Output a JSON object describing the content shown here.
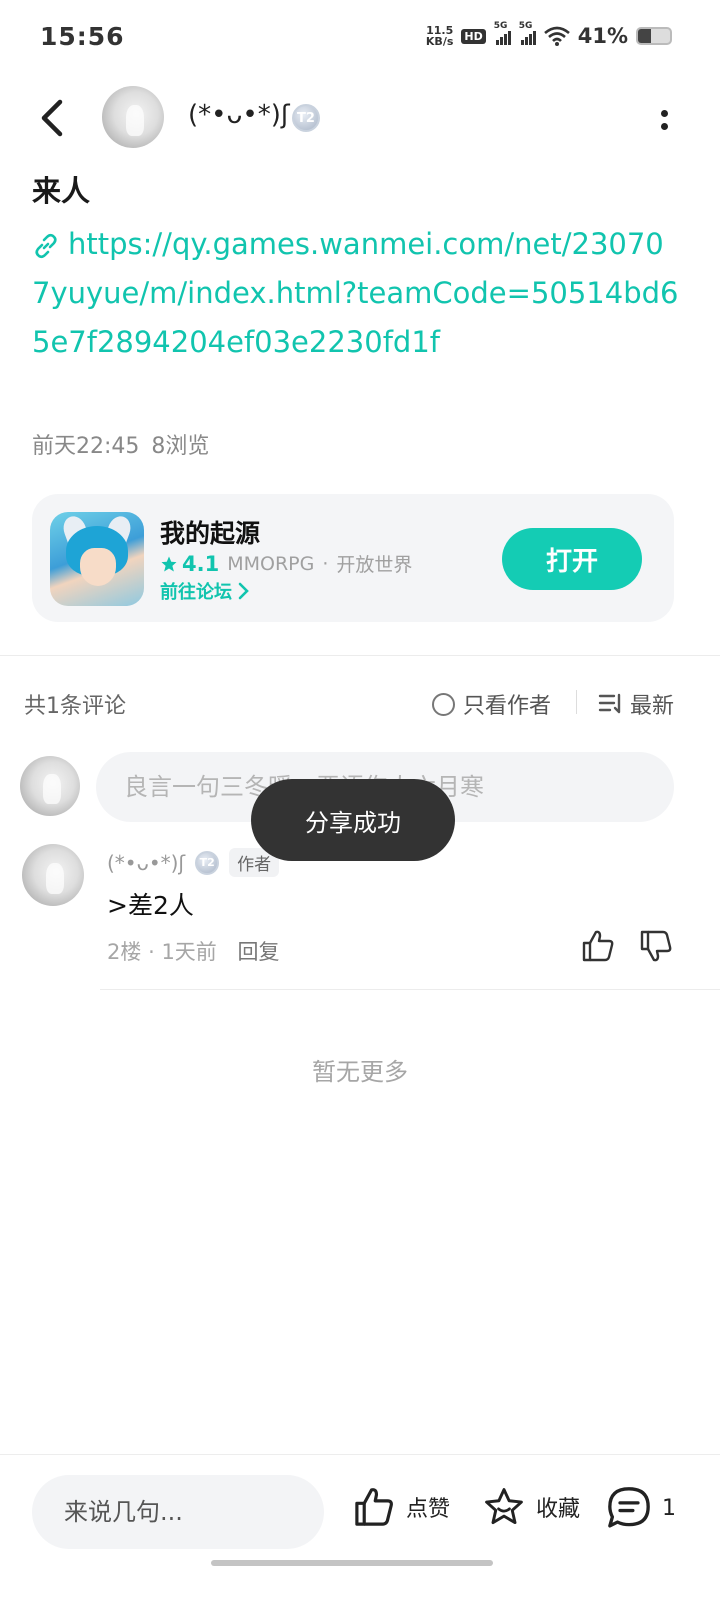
{
  "status_bar": {
    "time": "15:56",
    "net_speed_value": "11.5",
    "net_speed_unit": "KB/s",
    "hd_label": "HD",
    "signal1_label": "5G",
    "signal2_label": "5G",
    "battery_percent": "41%",
    "battery_level": 0.41
  },
  "header": {
    "username": "(*•ᴗ•*)ʃ",
    "level_badge": "T2"
  },
  "post": {
    "title": "来人",
    "link": "https://qy.games.wanmei.com/net/230707yuyue/m/index.html?teamCode=50514bd65e7f2894204ef03e2230fd1f",
    "time": "前天22:45",
    "views": "8浏览"
  },
  "game_card": {
    "name": "我的起源",
    "rating": "4.1",
    "genre": "MMORPG",
    "separator": "·",
    "tag": "开放世界",
    "forum_label": "前往论坛",
    "open_label": "打开"
  },
  "comments_section": {
    "count_label": "共1条评论",
    "author_only_label": "只看作者",
    "sort_label": "最新",
    "input_placeholder": "良言一句三冬暖，恶语伤人六月寒"
  },
  "toast": {
    "text": "分享成功"
  },
  "comments": [
    {
      "username": "(*•ᴗ•*)ʃ",
      "level_badge": "T2",
      "author_tag": "作者",
      "text": ">差2人",
      "floor": "2楼",
      "dot": "·",
      "time": "1天前",
      "reply_label": "回复"
    }
  ],
  "no_more": "暂无更多",
  "bottom_bar": {
    "input_placeholder": "来说几句...",
    "like_label": "点赞",
    "favorite_label": "收藏",
    "comment_count": "1"
  },
  "colors": {
    "accent": "#11c4ae",
    "open_button": "#14ccb4",
    "toast_bg": "#333333"
  }
}
